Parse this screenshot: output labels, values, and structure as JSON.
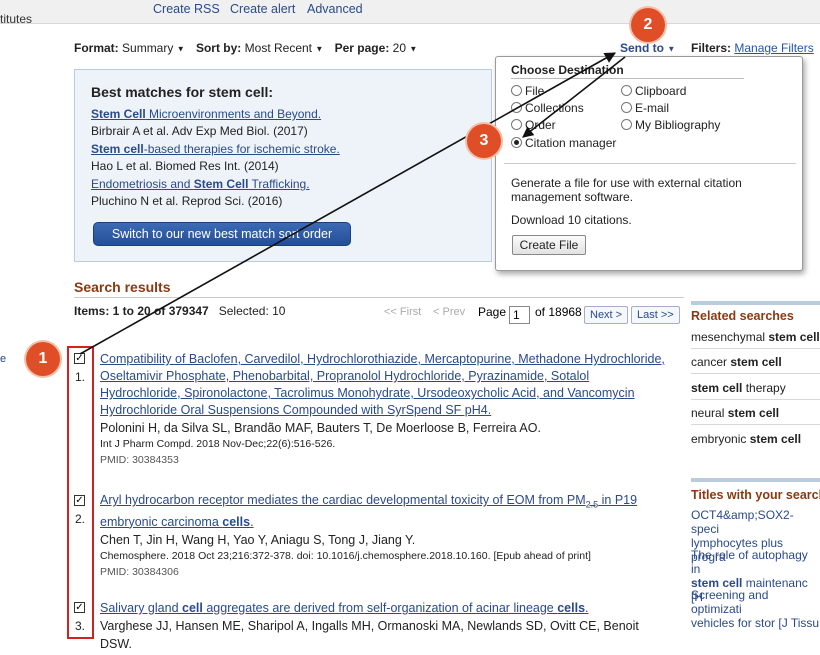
{
  "topbar": {
    "left_fragment": "titutes",
    "links": [
      "Create RSS",
      "Create alert",
      "Advanced"
    ]
  },
  "display": {
    "format_label": "Format:",
    "format_value": "Summary",
    "sort_label": "Sort by:",
    "sort_value": "Most Recent",
    "perpage_label": "Per page:",
    "perpage_value": "20",
    "send_to": "Send to",
    "filters_label": "Filters:",
    "filters_link": "Manage Filters"
  },
  "best_matches": {
    "heading": "Best matches for stem cell:",
    "items": [
      {
        "title_pre": "",
        "title_bold": "Stem Cell",
        "title_post": " Microenvironments and Beyond.",
        "meta": "Birbrair A et al. Adv Exp Med Biol. (2017)"
      },
      {
        "title_pre": "",
        "title_bold": "Stem cell",
        "title_post": "-based therapies for ischemic stroke.",
        "meta": "Hao L et al. Biomed Res Int. (2014)"
      },
      {
        "title_pre": "Endometriosis and ",
        "title_bold": "Stem Cell",
        "title_post": " Trafficking.",
        "meta": "Pluchino N et al. Reprod Sci. (2016)"
      }
    ],
    "button": "Switch to our new best match sort order"
  },
  "send_to_menu": {
    "heading": "Choose Destination",
    "options": {
      "file": "File",
      "clipboard": "Clipboard",
      "collections": "Collections",
      "email": "E-mail",
      "order": "Order",
      "bibliography": "My Bibliography",
      "citation": "Citation manager"
    },
    "selected": "citation",
    "description": "Generate a file for use with external citation management software.",
    "download_text": "Download 10 citations.",
    "button": "Create File"
  },
  "results": {
    "heading": "Search results",
    "items_label": "Items: 1 to 20 of 379347",
    "selected_label": "Selected: 10",
    "pager": {
      "first": "<< First",
      "prev": "< Prev",
      "page_label": "Page",
      "page_value": "1",
      "of_label": "of 18968",
      "next": "Next >",
      "last": "Last >>"
    },
    "list": [
      {
        "number": "1.",
        "checked": true,
        "title": "Compatibility of Baclofen, Carvedilol, Hydrochlorothiazide, Mercaptopurine, Methadone Hydrochloride, Oseltamivir Phosphate, Phenobarbital, Propranolol Hydrochloride, Pyrazinamide, Sotalol Hydrochloride, Spironolactone, Tacrolimus Monohydrate, Ursodeoxycholic Acid, and Vancomycin Hydrochloride Oral Suspensions Compounded with SyrSpend SF pH4.",
        "authors": "Polonini H, da Silva SL, Brandão MAF, Bauters T, De Moerloose B, Ferreira AO.",
        "citation": "Int J Pharm Compd. 2018 Nov-Dec;22(6):516-526.",
        "pmid": "PMID: 30384353"
      },
      {
        "number": "2.",
        "checked": true,
        "title_a": "Aryl hydrocarbon receptor mediates the cardiac developmental toxicity of EOM from PM",
        "title_sub": "2.5",
        "title_b": " in P19",
        "title_c": "embryonic carcinoma ",
        "title_bold": "cells",
        "title_end": ".",
        "authors": "Chen T, Jin H, Wang H, Yao Y, Aniagu S, Tong J, Jiang Y.",
        "citation": "Chemosphere. 2018 Oct 23;216:372-378. doi: 10.1016/j.chemosphere.2018.10.160. [Epub ahead of print]",
        "pmid": "PMID: 30384306"
      },
      {
        "number": "3.",
        "checked": true,
        "title_a": "Salivary gland ",
        "title_bold1": "cell",
        "title_b": " aggregates are derived from self-organization of acinar lineage ",
        "title_bold2": "cells",
        "title_end": ".",
        "authors": "Varghese JJ, Hansen ME, Sharipol A, Ingalls MH, Ormanoski MA, Newlands SD, Ovitt CE, Benoit DSW."
      }
    ]
  },
  "related": {
    "heading": "Related searches",
    "items": [
      {
        "pre": "mesenchymal ",
        "bold": "stem cell"
      },
      {
        "pre": "cancer ",
        "bold": "stem cell"
      },
      {
        "pre": "",
        "bold": "stem cell",
        "post": " therapy"
      },
      {
        "pre": "neural ",
        "bold": "stem cell"
      },
      {
        "pre": "embryonic ",
        "bold": "stem cell"
      }
    ]
  },
  "titles_with_terms": {
    "heading": "Titles with your search",
    "items": [
      {
        "line1": "OCT4&amp;SOX2-speci",
        "line2": "lymphocytes plus progra"
      },
      {
        "line1": "The role of autophagy in",
        "line2_bold": "stem cell",
        "line2": " maintenanc [H"
      },
      {
        "line1": "Screening and optimizati",
        "line2": "vehicles for stor [J Tissu"
      }
    ]
  },
  "annotations": {
    "badge1": "1",
    "badge2": "2",
    "badge3": "3",
    "badge_color": "#e04e28",
    "box_color": "#d32020"
  }
}
